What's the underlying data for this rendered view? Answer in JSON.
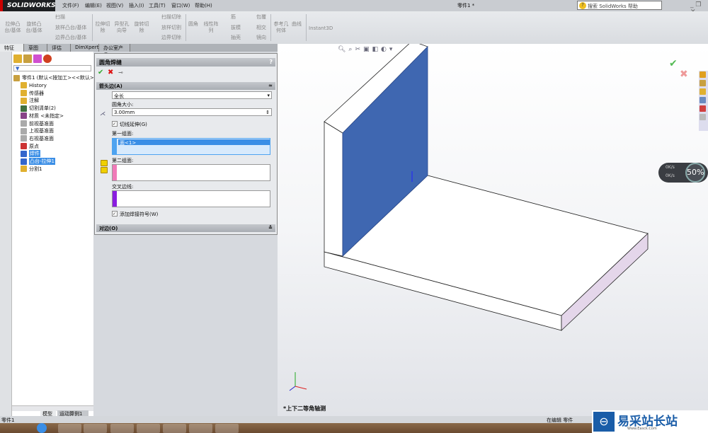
{
  "app": {
    "logo": "SOLIDWORKS",
    "document_title": "零件1 *",
    "search_placeholder": "搜索 SolidWorks 帮助"
  },
  "menu": [
    "文件(F)",
    "编辑(E)",
    "视图(V)",
    "插入(I)",
    "工具(T)",
    "窗口(W)",
    "帮助(H)"
  ],
  "ribbon": {
    "groups": [
      [
        "拉伸凸台/基体",
        "旋转凸台/基体",
        "扫描",
        "放样凸台/基体",
        "边界凸台/基体"
      ],
      [
        "拉伸切除",
        "异型孔向导",
        "旋转切除",
        "扫描切除",
        "放样切割",
        "边界切除"
      ],
      [
        "圆角",
        "线性阵列",
        "筋",
        "拔模",
        "抽壳",
        "包覆",
        "相交",
        "镜向"
      ],
      [
        "参考几何体",
        "曲线"
      ],
      [
        "Instant3D"
      ]
    ]
  },
  "tabs": [
    "特征",
    "草图",
    "评估",
    "DimXpert",
    "办公室产品"
  ],
  "tree": {
    "root": "零件1 (默认<按加工><<默认>",
    "items": [
      {
        "label": "History",
        "color": "#e0b030"
      },
      {
        "label": "传感器",
        "color": "#e0b030"
      },
      {
        "label": "注解",
        "color": "#e0b030"
      },
      {
        "label": "切割清单(2)",
        "color": "#407040"
      },
      {
        "label": "材质 <未指定>",
        "color": "#884488"
      },
      {
        "label": "前视基准面",
        "color": "#aaaaaa"
      },
      {
        "label": "上视基准面",
        "color": "#aaaaaa"
      },
      {
        "label": "右视基准面",
        "color": "#aaaaaa"
      },
      {
        "label": "原点",
        "color": "#cc3333"
      },
      {
        "label": "焊件",
        "color": "#3366cc",
        "selected": true
      },
      {
        "label": "凸台-拉伸1",
        "color": "#3366cc",
        "selected": true
      },
      {
        "label": "分割1",
        "color": "#e0b030"
      }
    ]
  },
  "property_manager": {
    "title": "圆角焊缝",
    "help": "?",
    "section1": "箭头边(A)",
    "type_value": "全长",
    "size_label": "圆角大小:",
    "size_value": "3.00mm",
    "tangent_label": "切线延伸(G)",
    "tangent_checked": true,
    "group1_label": "第一组面:",
    "group1_item": "面<1>",
    "group2_label": "第二组面:",
    "intersect_label": "交叉边线:",
    "symbol_label": "添加焊接符号(W)",
    "symbol_checked": true,
    "section2": "对边(O)"
  },
  "viewport": {
    "view_label": "*上下二等角轴测"
  },
  "bottom_tabs": [
    "模型",
    "运动算例1"
  ],
  "status": {
    "left": "零件1",
    "right": "在编辑 零件"
  },
  "net_widget": {
    "up": "0K/s",
    "down": "0K/s",
    "percent": "50%"
  },
  "watermark": {
    "text": "易采站长站",
    "sub": "Www.Easck.Com"
  },
  "colors": {
    "face_highlight": "#3f67b1",
    "group1": "#4ea3f0",
    "group2": "#f07ab8",
    "intersect": "#8a1ee0"
  }
}
